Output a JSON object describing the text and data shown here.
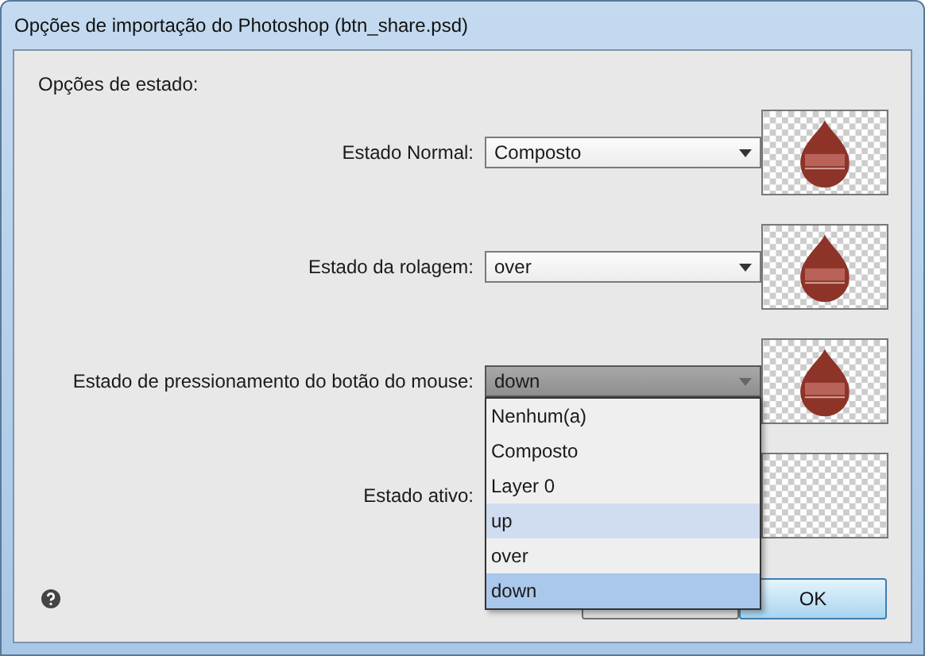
{
  "window": {
    "title": "Opções de importação do Photoshop (btn_share.psd)"
  },
  "section_title": "Opções de estado:",
  "states": [
    {
      "label": "Estado Normal:",
      "value": "Composto",
      "open": false,
      "preview": true
    },
    {
      "label": "Estado da rolagem:",
      "value": "over",
      "open": false,
      "preview": true
    },
    {
      "label": "Estado de pressionamento do botão do mouse:",
      "value": "down",
      "open": true,
      "preview": true
    },
    {
      "label": "Estado ativo:",
      "preview": false
    }
  ],
  "dropdown_options": [
    {
      "label": "Nenhum(a)",
      "hovered": false,
      "selected": false
    },
    {
      "label": "Composto",
      "hovered": false,
      "selected": false
    },
    {
      "label": "Layer 0",
      "hovered": false,
      "selected": false
    },
    {
      "label": "up",
      "hovered": true,
      "selected": false
    },
    {
      "label": "over",
      "hovered": false,
      "selected": false
    },
    {
      "label": "down",
      "hovered": false,
      "selected": true
    }
  ],
  "buttons": [
    {
      "kind": "cancel"
    },
    {
      "label": "OK",
      "kind": "ok"
    }
  ]
}
